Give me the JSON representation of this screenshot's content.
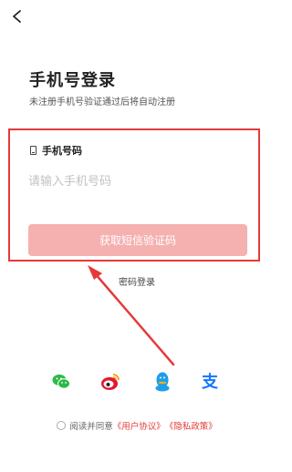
{
  "header": {
    "back_icon": "chevron-left-icon"
  },
  "login": {
    "title": "手机号登录",
    "subtitle": "未注册手机号验证通过后将自动注册",
    "phone_label": "手机号码",
    "phone_placeholder": "请输入手机号码",
    "phone_value": "",
    "sms_button": "获取短信验证码",
    "password_login": "密码登录"
  },
  "social": [
    {
      "name": "wechat-icon",
      "color": "#2bbb48"
    },
    {
      "name": "weibo-icon",
      "color": "#e6162d"
    },
    {
      "name": "qq-icon",
      "color": "#1e9de8"
    },
    {
      "name": "alipay-icon",
      "color": "#1677ff"
    }
  ],
  "agreement": {
    "prefix": "阅读并同意",
    "user_agreement": "《用户协议》",
    "privacy_policy": "《隐私政策》",
    "checked": false
  },
  "colors": {
    "highlight_border": "#e53a3a",
    "button_bg": "#f5b0b0",
    "link": "#e53a3a"
  }
}
